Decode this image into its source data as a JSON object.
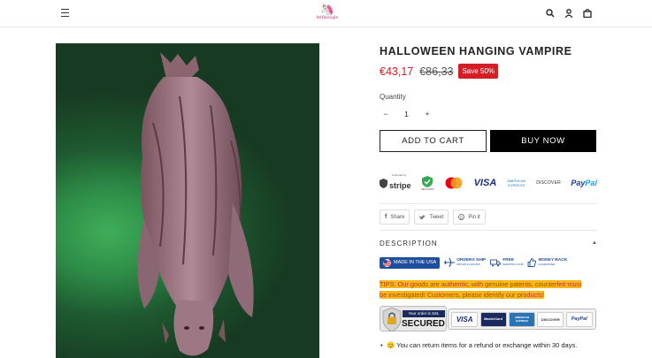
{
  "header": {
    "logo_text": "fetfinoogle",
    "icons": [
      "menu-icon",
      "search-icon",
      "account-icon",
      "cart-icon"
    ]
  },
  "product": {
    "title": "HALLOWEEN HANGING VAMPIRE",
    "price_now": "€43,17",
    "price_old": "€86,33",
    "save_badge": "Save 50%",
    "quantity_label": "Quantity",
    "quantity_value": "1",
    "qty_minus": "−",
    "qty_plus": "+",
    "add_to_cart": "ADD TO CART",
    "buy_now": "BUY NOW"
  },
  "payments": {
    "stripe_caption": "Powered by",
    "stripe": "stripe",
    "secure_caption": "SECURED",
    "visa": "VISA",
    "amex": "AMERICAN EXPRESS",
    "discover": "DISCOVER",
    "paypal_a": "Pay",
    "paypal_b": "Pal"
  },
  "share": {
    "share": "Share",
    "tweet": "Tweet",
    "pin": "Pin it"
  },
  "description": {
    "title": "DESCRIPTION",
    "toggle": "▲",
    "usa": "MADE IN THE USA",
    "orders_ship": "ORDERS SHIP",
    "orders_ship_sub": "WITHIN 24 HOURS",
    "free_shipping": "FREE",
    "free_shipping_sub": "SHIPPING CLUB",
    "money_back": "MONEY BACK",
    "money_back_sub": "GUARANTEE",
    "tips": "TIPS: Our goods are authentic, with genuine patents, counterfeit must be investigated! Customers, please identify our products!",
    "ssl_small": "Your order is SSL",
    "ssl_big": "SECURED",
    "card_visa": "VISA",
    "card_master": "MasterCard",
    "card_amex": "AMERICAN EXPRESS",
    "card_discover": "DISCOVER",
    "card_paypal": "PayPal",
    "return_text": "😊 You can return items for a refund or exchange within 30 days."
  },
  "colors": {
    "accent_red": "#d21e24",
    "highlight": "#f5b916"
  }
}
